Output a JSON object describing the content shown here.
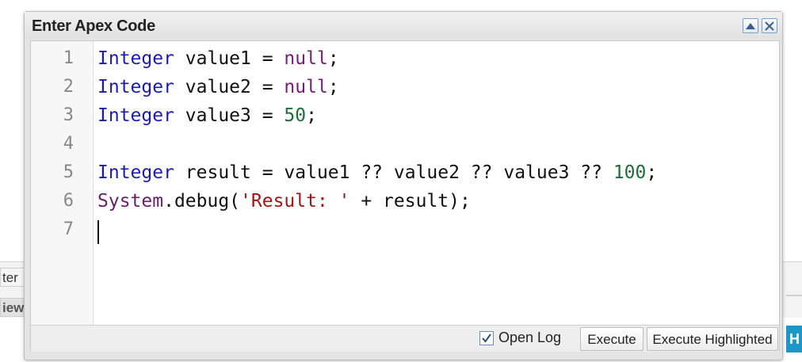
{
  "background": {
    "tab1_label": "ter",
    "tab2_label": "iew",
    "right_button_label": "H"
  },
  "dialog": {
    "title": "Enter Apex Code",
    "line_numbers": [
      "1",
      "2",
      "3",
      "4",
      "5",
      "6",
      "7"
    ],
    "code_tokens": {
      "l1": [
        "Integer",
        " value1 = ",
        "null",
        ";"
      ],
      "l2": [
        "Integer",
        " value2 = ",
        "null",
        ";"
      ],
      "l3": [
        "Integer",
        " value3 = ",
        "50",
        ";"
      ],
      "l5": [
        "Integer",
        " result = value1 ?? value2 ?? value3 ?? ",
        "100",
        ";"
      ],
      "l6": [
        "System",
        ".debug(",
        "'Result: '",
        " + result);"
      ]
    },
    "open_log_label": "Open Log",
    "open_log_checked": true,
    "execute_label": "Execute",
    "execute_highlighted_label": "Execute Highlighted"
  },
  "colors": {
    "keyword": "#1a1ab8",
    "null_literal": "#7a1b7a",
    "number_literal": "#1e6e3a",
    "string_literal": "#a31515"
  }
}
